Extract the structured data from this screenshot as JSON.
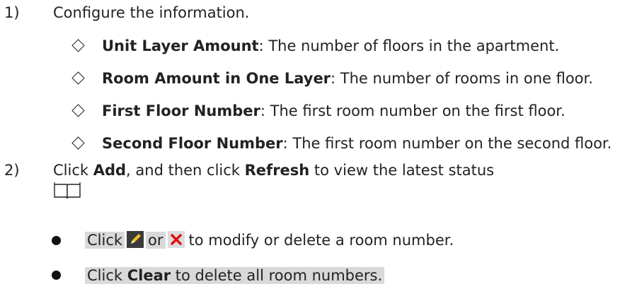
{
  "steps": [
    {
      "num": "1)",
      "text": "Configure the information."
    },
    {
      "num": "2)",
      "pre": "Click ",
      "b1": "Add",
      "mid": ", and then click ",
      "b2": "Refresh",
      "post": " to view the latest status"
    }
  ],
  "fields": [
    {
      "term": "Unit Layer Amount",
      "desc": ": The number of floors in the apartment."
    },
    {
      "term": "Room Amount in One Layer",
      "desc": ": The number of rooms in one floor."
    },
    {
      "term": "First Floor Number",
      "desc": ": The first room number on the first floor."
    },
    {
      "term": "Second Floor Number",
      "desc": ": The first room number on the second floor."
    }
  ],
  "notes": [
    {
      "pre": "Click",
      "or": "or",
      "post": "to modify or delete a room number.",
      "icons": [
        "edit-icon",
        "delete-icon"
      ]
    },
    {
      "pre": "Click ",
      "b": "Clear",
      "post": " to delete all room numbers."
    }
  ],
  "colors": {
    "highlight": "#d9d9d9",
    "edit_bg": "#3a3a3a",
    "edit_pen": "#f2c21b",
    "delete_bg": "#dcdcdc",
    "delete_x": "#e01010"
  },
  "note_icon": "book-icon"
}
